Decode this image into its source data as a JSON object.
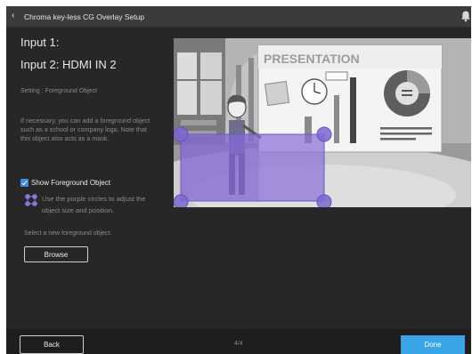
{
  "window": {
    "title": "Chroma key-less CG Overlay Setup",
    "back_glyph": "‹"
  },
  "panel": {
    "input1": "Input 1:",
    "input2": "Input 2: HDMI IN 2",
    "setting": "Setting : Foreground Object",
    "description": "If necessary, you can add a foreground object such as a school or company logo. Note that this object also acts as a mask.",
    "show_foreground_label": "Show Foreground Object",
    "show_foreground_checked": true,
    "hint": "Use the purple circles to adjust the object size and position.",
    "select_text": "Select a new foreground object.",
    "browse_label": "Browse"
  },
  "preview": {
    "board_title": "PRESENTATION",
    "overlay_color": "#8a6fd8"
  },
  "footer": {
    "back_label": "Back",
    "page": "4/4",
    "done_label": "Done"
  },
  "colors": {
    "accent": "#39a5e6",
    "checkbox": "#3d8be0",
    "handle": "#7e66d0"
  },
  "icons": [
    "chevron-left-icon",
    "bell-icon",
    "resize-handles-icon"
  ]
}
